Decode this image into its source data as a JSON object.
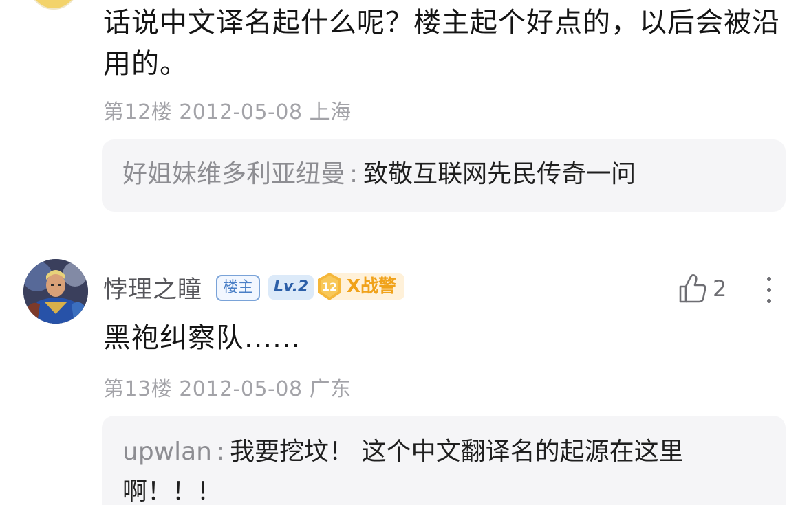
{
  "post12": {
    "content": "话说中文译名起什么呢？楼主起个好点的，以后会被沿用的。",
    "meta": "第12楼 2012-05-08 上海",
    "reply": {
      "author": "好姐妹维多利亚纽曼",
      "separator": ":",
      "text": "致敬互联网先民传奇一问"
    }
  },
  "post13": {
    "username": "悖理之瞳",
    "owner_badge": "楼主",
    "level_badge": "Lv.2",
    "rank_number": "12",
    "rank_title": "X战警",
    "like_count": "2",
    "content": "黑袍纠察队......",
    "meta": "第13楼 2012-05-08 广东",
    "reply": {
      "author": "upwlan",
      "separator": ":",
      "text": "我要挖坟！ 这个中文翻译名的起源在这里啊！！！"
    }
  },
  "colors": {
    "meta_gray": "#a3a3a8",
    "reply_bg": "#f5f5f7",
    "owner_badge_blue": "#4a7fc6",
    "rank_orange": "#f0a21a"
  },
  "icons": {
    "like": "thumbs-up-icon",
    "more": "more-vertical-icon"
  }
}
